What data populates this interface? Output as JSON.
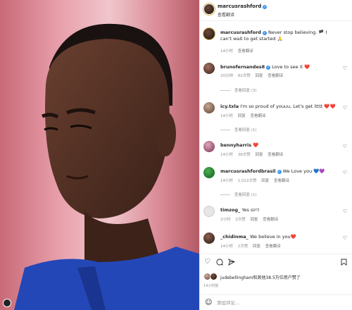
{
  "colors": {
    "accent": "#3897f0",
    "like_red": "#ed4956",
    "text": "#262626",
    "muted": "#8e8e8e"
  },
  "post": {
    "username": "marcusrashford",
    "subtitle": "查看翻译",
    "caption_user": "marcusrashford",
    "caption_text": "Never stop believing. 🏴 I can't wait to get started 🙏",
    "caption_time": "14小时",
    "caption_translate": "查看翻译"
  },
  "comments": [
    {
      "user": "brunofernandes8",
      "text": "Love to see it ❤️",
      "time": "20分钟",
      "likes": "82次赞",
      "reply": "回复",
      "translate": "查看翻译",
      "replies": "查看回复 (3)"
    },
    {
      "user": "icy.txla",
      "text": "I'm so proud of youuu, Let's get itttt ❤️❤️",
      "time": "14小时",
      "likes": "",
      "reply": "回复",
      "translate": "查看翻译",
      "replies": "查看回复 (1)"
    },
    {
      "user": "bennyharris",
      "text": "❤️",
      "time": "14小时",
      "likes": "38次赞",
      "reply": "回复",
      "translate": "查看翻译",
      "replies": ""
    },
    {
      "user": "marcusrashfordbrasil",
      "text": "We Love you 💙💜",
      "time": "14小时",
      "likes": "1,022次赞",
      "reply": "回复",
      "translate": "查看翻译",
      "replies": "查看回复 (1)"
    },
    {
      "user": "timzog_",
      "text": "Yes sir!!",
      "time": "2小时",
      "likes": "2次赞",
      "reply": "回复",
      "translate": "查看翻译",
      "replies": ""
    },
    {
      "user": "_chidinma_",
      "text": "We believe in you❤️",
      "time": "14小时",
      "likes": "2次赞",
      "reply": "回复",
      "translate": "查看翻译",
      "replies": ""
    }
  ],
  "likes": {
    "text": "jude​bellingham和其他38.5万位用户赞了"
  },
  "time_ago": "14小时前",
  "add_comment": {
    "placeholder": "添加评论..."
  },
  "icons": {
    "more": "more-icon",
    "like": "heart-icon",
    "comment": "comment-icon",
    "share": "share-icon",
    "save": "bookmark-icon",
    "emoji": "emoji-icon"
  }
}
